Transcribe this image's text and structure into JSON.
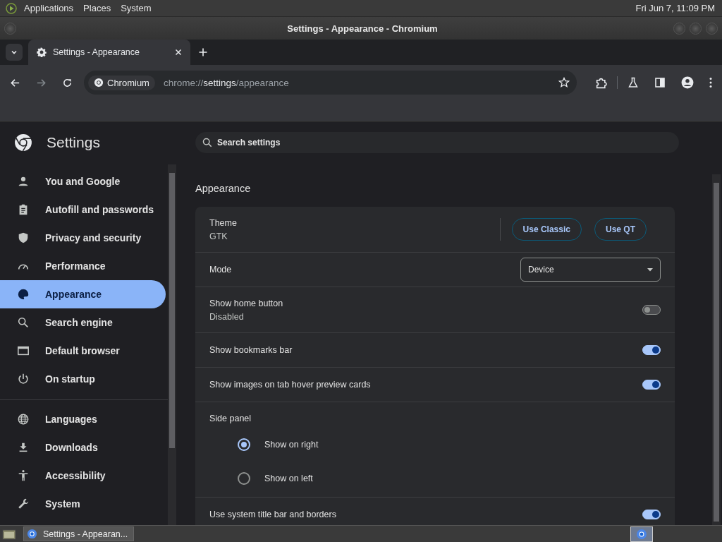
{
  "top_panel": {
    "menus": [
      "Applications",
      "Places",
      "System"
    ],
    "clock": "Fri Jun  7, 11:09 PM"
  },
  "window": {
    "title": "Settings - Appearance - Chromium"
  },
  "tabs": [
    {
      "label": "Settings - Appearance",
      "selected": true
    }
  ],
  "toolbar": {
    "site_chip": "Chromium",
    "url": {
      "scheme": "chrome://",
      "host": "settings",
      "path": "/appearance"
    }
  },
  "settings": {
    "title": "Settings",
    "search_placeholder": "Search settings",
    "nav_sections": [
      [
        {
          "label": "You and Google",
          "selected": false
        },
        {
          "label": "Autofill and passwords",
          "selected": false
        },
        {
          "label": "Privacy and security",
          "selected": false
        },
        {
          "label": "Performance",
          "selected": false
        },
        {
          "label": "Appearance",
          "selected": true
        },
        {
          "label": "Search engine",
          "selected": false
        },
        {
          "label": "Default browser",
          "selected": false
        },
        {
          "label": "On startup",
          "selected": false
        }
      ],
      [
        {
          "label": "Languages",
          "selected": false
        },
        {
          "label": "Downloads",
          "selected": false
        },
        {
          "label": "Accessibility",
          "selected": false
        },
        {
          "label": "System",
          "selected": false
        }
      ]
    ],
    "section_title": "Appearance",
    "rows": [
      {
        "kind": "theme",
        "label": "Theme",
        "sublabel": "GTK",
        "buttons": [
          "Use Classic",
          "Use QT"
        ]
      },
      {
        "kind": "select",
        "label": "Mode",
        "value": "Device"
      },
      {
        "kind": "toggle",
        "label": "Show home button",
        "sublabel": "Disabled",
        "on": false
      },
      {
        "kind": "toggle",
        "label": "Show bookmarks bar",
        "on": true
      },
      {
        "kind": "toggle",
        "label": "Show images on tab hover preview cards",
        "on": true
      },
      {
        "kind": "radio",
        "label": "Side panel",
        "options": [
          {
            "label": "Show on right",
            "selected": true
          },
          {
            "label": "Show on left",
            "selected": false
          }
        ]
      },
      {
        "kind": "toggle",
        "label": "Use system title bar and borders",
        "on": true
      }
    ]
  },
  "taskbar": {
    "tasks": [
      {
        "label": "Settings - Appearan...",
        "selected": false
      }
    ]
  }
}
